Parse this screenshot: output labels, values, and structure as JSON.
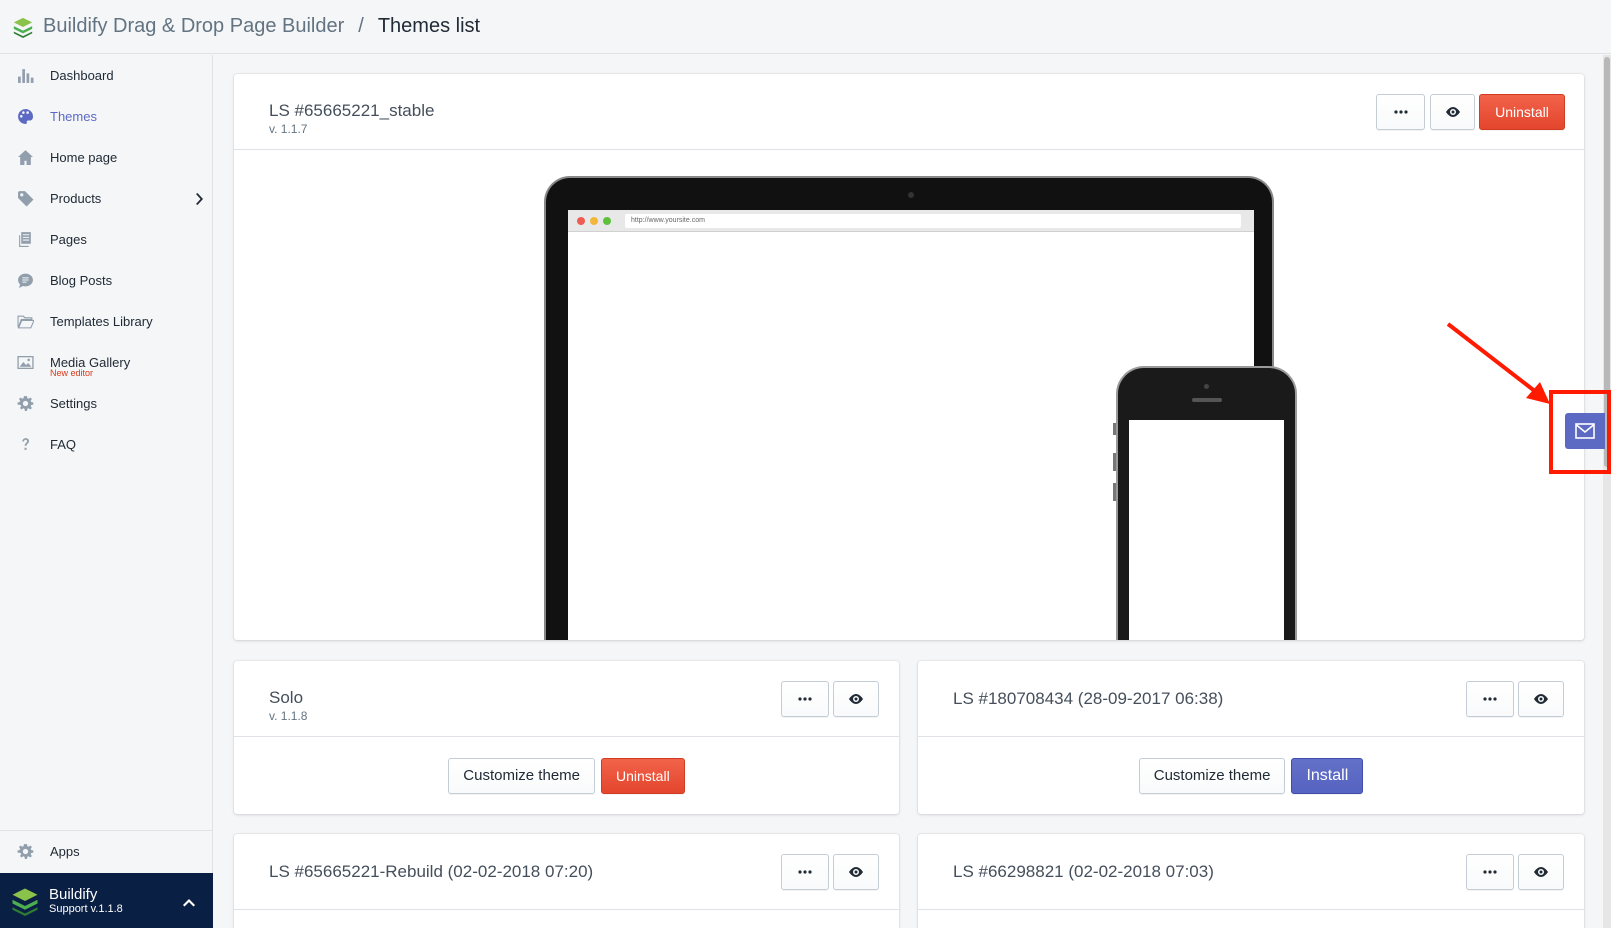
{
  "topbar": {
    "app_name": "Buildify Drag & Drop Page Builder",
    "separator": "/",
    "page_title": "Themes list",
    "logo_icon": "buildify-logo-icon"
  },
  "sidebar": {
    "items": [
      {
        "label": "Dashboard",
        "icon": "bar-chart-icon",
        "active": false
      },
      {
        "label": "Themes",
        "icon": "paint-palette-icon",
        "active": true
      },
      {
        "label": "Home page",
        "icon": "home-icon",
        "active": false
      },
      {
        "label": "Products",
        "icon": "tag-icon",
        "active": false,
        "has_submenu": true
      },
      {
        "label": "Pages",
        "icon": "pages-icon",
        "active": false
      },
      {
        "label": "Blog Posts",
        "icon": "comment-icon",
        "active": false
      },
      {
        "label": "Templates Library",
        "icon": "folder-open-icon",
        "active": false
      },
      {
        "label": "Media Gallery",
        "icon": "image-icon",
        "active": false,
        "note": "New editor"
      },
      {
        "label": "Settings",
        "icon": "gear-icon",
        "active": false
      },
      {
        "label": "FAQ",
        "icon": "question-icon",
        "active": false
      }
    ],
    "apps": {
      "label": "Apps",
      "icon": "puzzle-icon"
    },
    "support": {
      "name": "Buildify",
      "version": "Support v.1.1.8"
    }
  },
  "themes": {
    "main": {
      "title": "LS #65665221_stable",
      "version": "v. 1.1.7",
      "uninstall_label": "Uninstall",
      "preview_url": "http://www.yoursite.com"
    },
    "cards": [
      {
        "title": "Solo",
        "version": "v. 1.1.8",
        "customize_label": "Customize theme",
        "action_label": "Uninstall"
      },
      {
        "title": "LS #180708434 (28-09-2017 06:38)",
        "version": "",
        "customize_label": "Customize theme",
        "action_label": "Install"
      },
      {
        "title": "LS #65665221-Rebuild (02-02-2018 07:20)",
        "version": ""
      },
      {
        "title": "LS #66298821 (02-02-2018 07:03)",
        "version": ""
      }
    ]
  },
  "floating": {
    "mail_icon": "mail-icon"
  },
  "colors": {
    "accent": "#5c6ac4",
    "danger": "#de3618",
    "annotation": "#ff1a00",
    "support_bg": "#0a1f44"
  }
}
